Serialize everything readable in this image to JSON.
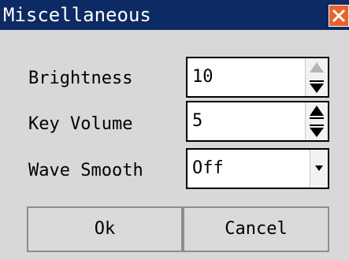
{
  "window": {
    "title": "Miscellaneous",
    "close_icon": "close-icon",
    "accent": "#0c2a64",
    "close_color": "#e8622a"
  },
  "fields": {
    "brightness": {
      "label": "Brightness",
      "value": "10"
    },
    "key_volume": {
      "label": "Key Volume",
      "value": "5"
    },
    "wave_smooth": {
      "label": "Wave Smooth",
      "value": "Off"
    }
  },
  "buttons": {
    "ok": "Ok",
    "cancel": "Cancel"
  }
}
